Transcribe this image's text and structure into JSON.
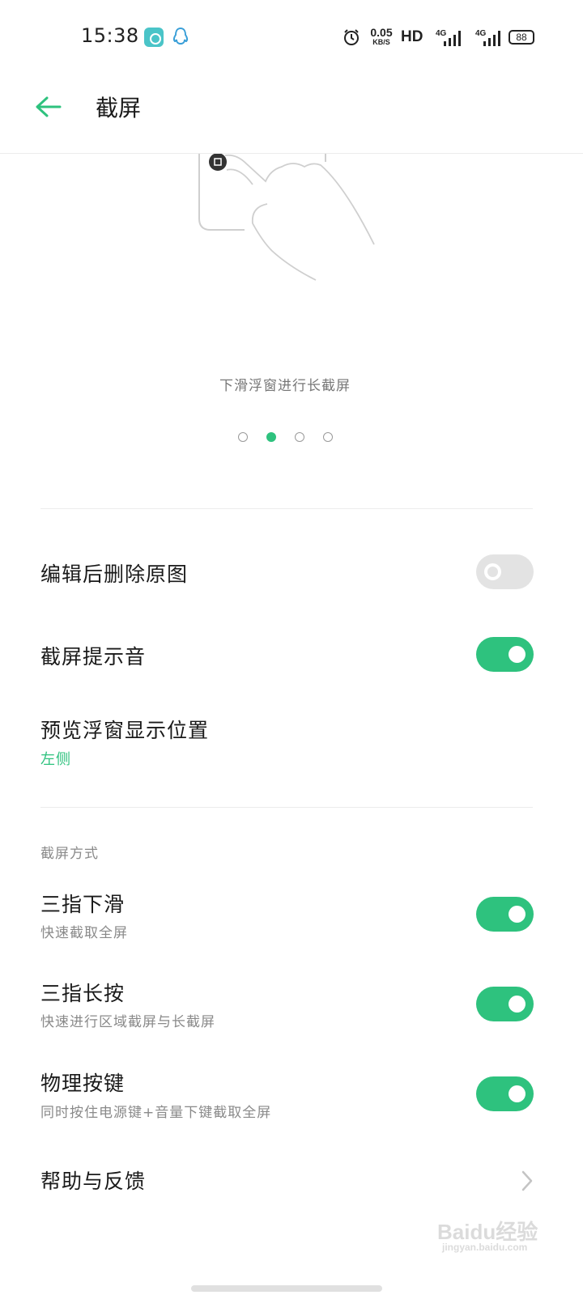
{
  "status_bar": {
    "time": "15:38",
    "net_speed_value": "0.05",
    "net_speed_unit": "KB/S",
    "hd_label": "HD",
    "signal_1_label": "4G",
    "signal_2_label": "4G",
    "battery": "88"
  },
  "header": {
    "title": "截屏"
  },
  "carousel": {
    "caption": "下滑浮窗进行长截屏",
    "page_count": 4,
    "active_index": 1
  },
  "settings": {
    "delete_after_edit": {
      "label": "编辑后删除原图",
      "enabled": false
    },
    "screenshot_sound": {
      "label": "截屏提示音",
      "enabled": true
    },
    "preview_position": {
      "label": "预览浮窗显示位置",
      "value": "左侧"
    }
  },
  "methods_section": {
    "label": "截屏方式",
    "three_finger_swipe": {
      "label": "三指下滑",
      "description": "快速截取全屏",
      "enabled": true
    },
    "three_finger_press": {
      "label": "三指长按",
      "description": "快速进行区域截屏与长截屏",
      "enabled": true
    },
    "physical_keys": {
      "label": "物理按键",
      "description": "同时按住电源键+音量下键截取全屏",
      "enabled": true
    }
  },
  "help": {
    "label": "帮助与反馈"
  },
  "watermark": {
    "text": "Baidu经验",
    "site": "jingyan.baidu.com"
  },
  "colors": {
    "accent": "#2ec27e",
    "toggle_off": "#e3e3e3"
  },
  "icons": [
    "back-arrow-icon",
    "alarm-icon",
    "signal-icon",
    "battery-icon",
    "chevron-right-icon"
  ]
}
